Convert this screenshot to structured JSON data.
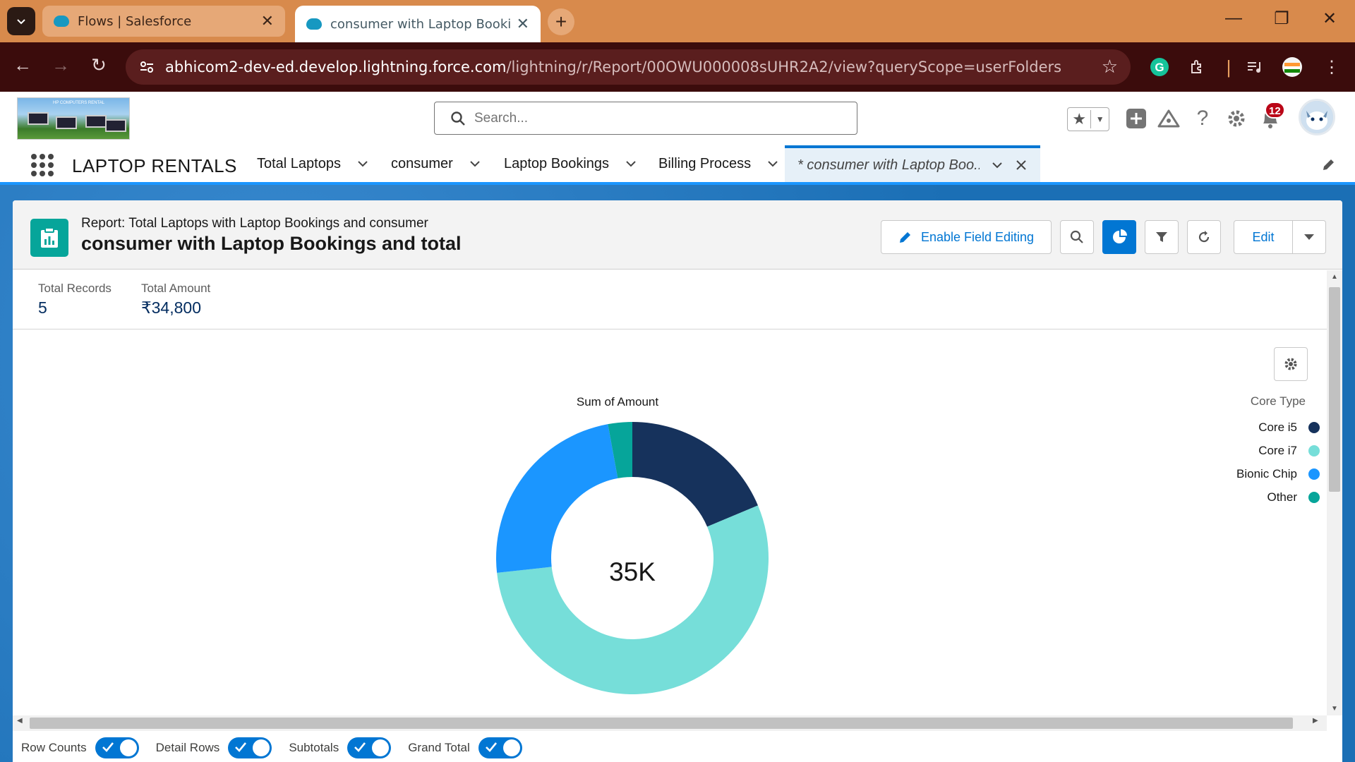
{
  "browser": {
    "tabs": [
      {
        "title": "Flows | Salesforce",
        "active": false
      },
      {
        "title": "consumer with Laptop Booking",
        "active": true
      }
    ],
    "url_host": "abhicom2-dev-ed.develop.lightning.force.com",
    "url_path": "/lightning/r/Report/00OWU000008sUHR2A2/view?queryScope=userFolders"
  },
  "header": {
    "search_placeholder": "Search...",
    "notification_count": "12"
  },
  "nav": {
    "app_name": "LAPTOP RENTALS",
    "items": [
      {
        "label": "Total Laptops"
      },
      {
        "label": "consumer"
      },
      {
        "label": "Laptop Bookings"
      },
      {
        "label": "Billing Process"
      },
      {
        "label": "* consumer with Laptop Boo..."
      }
    ]
  },
  "report": {
    "subtitle": "Report: Total Laptops with Laptop Bookings and consumer",
    "title": "consumer with Laptop Bookings and total",
    "buttons": {
      "enable_field_editing": "Enable Field Editing",
      "edit": "Edit"
    },
    "summary": [
      {
        "label": "Total Records",
        "value": "5"
      },
      {
        "label": "Total Amount",
        "value": "₹34,800"
      }
    ]
  },
  "chart_data": {
    "type": "pie",
    "title": "Sum of Amount",
    "center_label": "35K",
    "legend_title": "Core Type",
    "legend_position": "right",
    "series": [
      {
        "name": "Core i5",
        "value": 6500,
        "color": "#16325c"
      },
      {
        "name": "Core i7",
        "value": 19000,
        "color": "#76ded9"
      },
      {
        "name": "Bionic Chip",
        "value": 8300,
        "color": "#1b96ff"
      },
      {
        "name": "Other",
        "value": 1000,
        "color": "#06a59a"
      }
    ]
  },
  "footer": {
    "toggles": [
      {
        "label": "Row Counts",
        "on": true
      },
      {
        "label": "Detail Rows",
        "on": true
      },
      {
        "label": "Subtotals",
        "on": true
      },
      {
        "label": "Grand Total",
        "on": true
      }
    ]
  }
}
